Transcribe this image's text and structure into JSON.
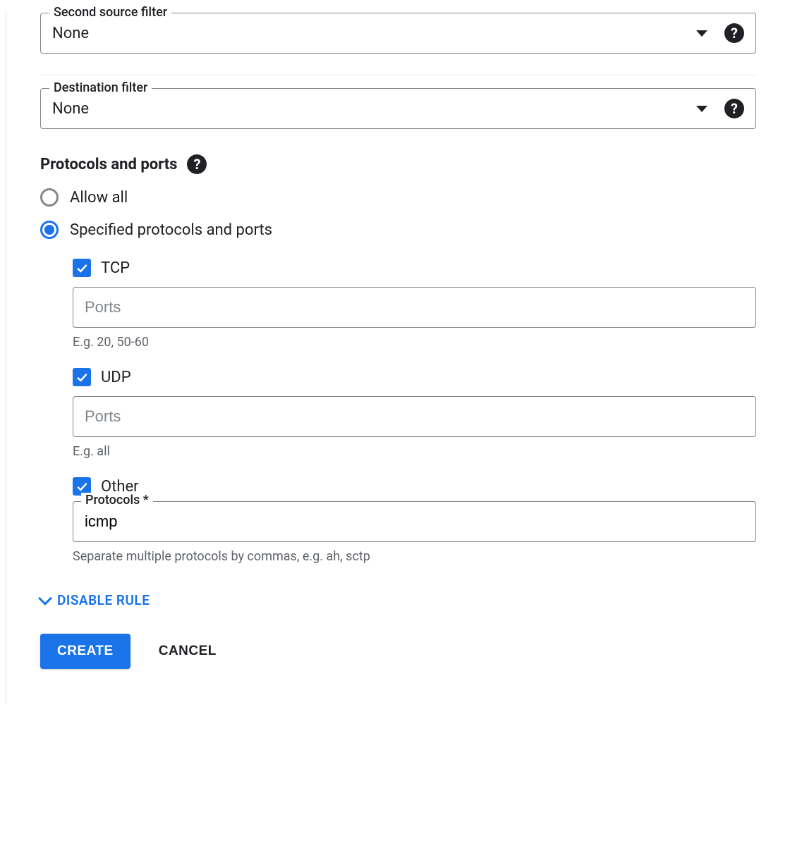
{
  "second_source_filter": {
    "label": "Second source filter",
    "value": "None"
  },
  "destination_filter": {
    "label": "Destination filter",
    "value": "None"
  },
  "protocols_section": {
    "title": "Protocols and ports",
    "radio_allow_all": "Allow all",
    "radio_specified": "Specified protocols and ports"
  },
  "tcp": {
    "label": "TCP",
    "ports_placeholder": "Ports",
    "hint": "E.g. 20, 50-60"
  },
  "udp": {
    "label": "UDP",
    "ports_placeholder": "Ports",
    "hint": "E.g. all"
  },
  "other": {
    "label": "Other",
    "protocols_label": "Protocols *",
    "value": "icmp",
    "hint": "Separate multiple protocols by commas, e.g. ah, sctp"
  },
  "disable_rule_label": "DISABLE RULE",
  "buttons": {
    "create": "CREATE",
    "cancel": "CANCEL"
  },
  "help_glyph": "?"
}
